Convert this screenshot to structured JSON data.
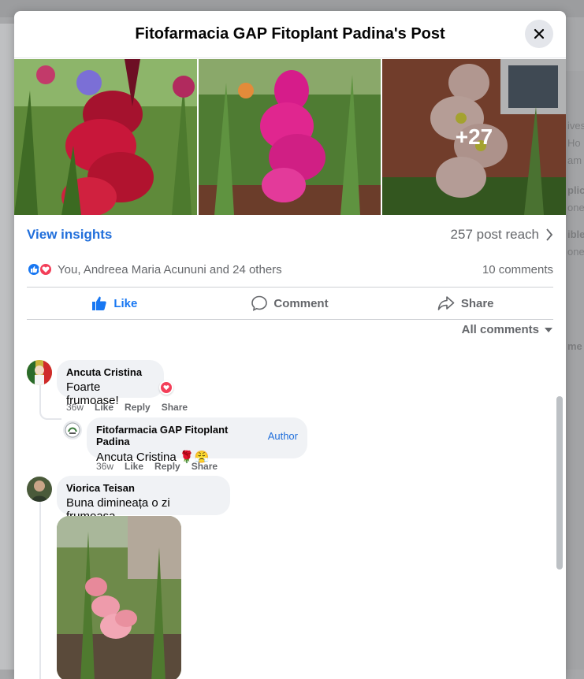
{
  "modal": {
    "title": "Fitofarmacia GAP Fitoplant Padina's Post",
    "more_photos_label": "+27"
  },
  "insights": {
    "link_label": "View insights",
    "reach_label": "257 post reach"
  },
  "reactions": {
    "summary": "You, Andreea Maria Acununi and 24 others",
    "comments_count": "10 comments"
  },
  "actions": {
    "like_label": "Like",
    "comment_label": "Comment",
    "share_label": "Share"
  },
  "sort": {
    "label": "All comments"
  },
  "comments": [
    {
      "author": "Ancuta Cristina",
      "text": "Foarte frumoase!",
      "time": "36w",
      "like": "Like",
      "reply": "Reply",
      "share": "Share"
    },
    {
      "author": "Fitofarmacia GAP Fitoplant Padina",
      "badge": "Author",
      "text": "Ancuta Cristina 🌹😤",
      "time": "36w",
      "like": "Like",
      "reply": "Reply",
      "share": "Share"
    },
    {
      "author": "Viorica Teisan",
      "text": "Buna dimineața o zi frumoasa"
    }
  ],
  "background": {
    "right_snippets": [
      "ives",
      "Ho",
      "am",
      "plic",
      "one",
      "ible",
      "one",
      "me"
    ]
  },
  "colors": {
    "accent": "#216fdb",
    "like_blue": "#1877f2",
    "love_red": "#f33e58",
    "bubble_bg": "#f0f2f5"
  }
}
